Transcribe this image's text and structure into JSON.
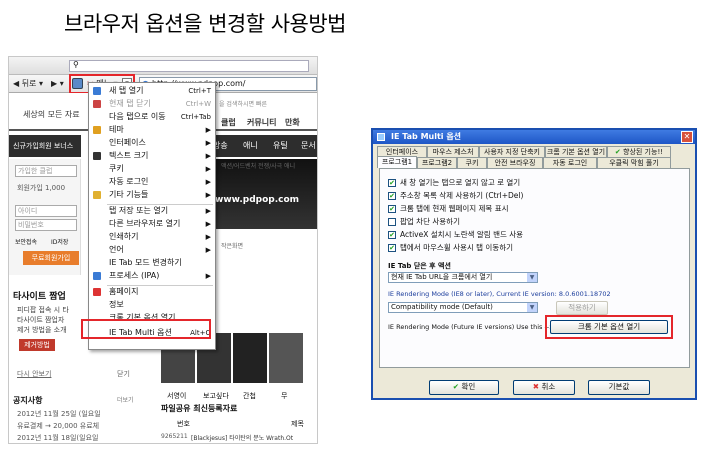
{
  "title": "브라우저 옵션을 변경할 사용방법",
  "browser": {
    "nav_back": "◀ 뒤로 ▾",
    "nav_fwd": "▶ ▾",
    "menu_button": "메뉴 ▾",
    "address": "http://www.pdpop.com/",
    "site": {
      "tagline": "세상의 모든 자료",
      "top_links": [
        "클럽",
        "커뮤니티",
        "만화"
      ],
      "notice_text": "신규가입회원 보너스",
      "gnb_items": [
        "방송",
        "애니",
        "유틸",
        "문서"
      ],
      "search_placeholder": "가입한 클럽",
      "join_line": "회원가입 1,000",
      "id_placeholder": "아이디",
      "pw_placeholder": "비밀번호",
      "login_opts": [
        "보안접속",
        "ID저장"
      ],
      "free_button": "무료회원가입",
      "banner_domain": "www.pdpop.com",
      "banner_hint": "작은화면",
      "caption_row": "액션/어드벤처 전쟁/사극 애니",
      "side_heading": "타사이트 짬업",
      "side_lines": [
        "피디팝 접속 시 타",
        "타사이트 짬업자",
        "제거 방법을 소개"
      ],
      "remove_button": "제거방법",
      "show_again": "다시 안보기",
      "close": "닫기",
      "movie_titles": [
        "서영이",
        "보고싶다",
        "간첩",
        "무"
      ],
      "notice_heading": "공지사항",
      "notice_more": "더보기",
      "notices": [
        "2012년 11월 25일 (일요일",
        "유료결제 → 20,000 유료체",
        "2012년 11월 18일(일요일"
      ],
      "files_heading": "파일공유 최신등록자료",
      "files_cols": [
        "번호",
        "제목"
      ],
      "file_row": [
        "9265211",
        "[Blackjesus] 타이탄의 분노 Wrath.Ot"
      ],
      "search_note": "을 검색하시면 빠른"
    },
    "menu": [
      {
        "label": "새 탭 열기",
        "shortcut": "Ctrl+T",
        "icon": "#3a7bd5",
        "disabled": false
      },
      {
        "label": "현재 탭 닫기",
        "shortcut": "Ctrl+W",
        "icon": "#c44",
        "disabled": true
      },
      {
        "label": "다음 탭으로 이동",
        "shortcut": "Ctrl+Tab",
        "icon": "",
        "disabled": false
      },
      {
        "label": "테마",
        "shortcut": "",
        "icon": "#e0a020",
        "arrow": true
      },
      {
        "label": "인터페이스",
        "shortcut": "",
        "icon": "",
        "arrow": true
      },
      {
        "label": "텍스트 크기",
        "shortcut": "",
        "icon": "#333",
        "arrow": true
      },
      {
        "label": "쿠키",
        "shortcut": "",
        "icon": "",
        "arrow": true
      },
      {
        "label": "자동 로그인",
        "shortcut": "",
        "icon": "",
        "arrow": true
      },
      {
        "label": "기타 기능들",
        "shortcut": "",
        "icon": "#e0b030",
        "arrow": true
      },
      {
        "label": "탭 저장 또는 열기",
        "shortcut": "",
        "icon": "",
        "arrow": true,
        "sep_before": true
      },
      {
        "label": "다른 브라우저로 열기",
        "shortcut": "",
        "icon": "",
        "arrow": true
      },
      {
        "label": "인쇄하기",
        "shortcut": "",
        "icon": "",
        "arrow": true
      },
      {
        "label": "언어",
        "shortcut": "",
        "icon": "",
        "arrow": true
      },
      {
        "label": "IE Tab 모드 변경하기",
        "shortcut": "",
        "icon": "",
        "arrow": false
      },
      {
        "label": "프로세스 (IPA)",
        "shortcut": "",
        "icon": "#3a7bd5",
        "arrow": true
      },
      {
        "label": "홈페이지",
        "shortcut": "",
        "icon": "#d33",
        "arrow": false,
        "sep_before": true
      },
      {
        "label": "정보",
        "shortcut": "",
        "icon": "",
        "arrow": false
      },
      {
        "label": "크롬 기본 옵션 열기",
        "shortcut": "",
        "icon": "",
        "arrow": false
      },
      {
        "label": "IE Tab Multi 옵션",
        "shortcut": "Alt+O",
        "icon": "",
        "arrow": false,
        "highlight": true
      }
    ]
  },
  "dialog": {
    "title": "IE Tab Multi 옵션",
    "tabs_row1": [
      "인터페이스",
      "마우스 제스처",
      "사용자 지정 단축키",
      "크롬 기본 옵션 열기",
      "향상된 기능!!"
    ],
    "tabs_row2": [
      "프로그램1",
      "프로그램2",
      "쿠키",
      "안전 브라우징",
      "자동 로그인",
      "우클릭 막힘 풀기"
    ],
    "checks": [
      {
        "label": "새 창 열기는 탭으로 열지 않고 로 열기",
        "checked": true
      },
      {
        "label": "주소창 목록 삭제 사용하기 (Ctrl+Del)",
        "checked": true
      },
      {
        "label": "크롬 탭에 현재 웹페이지 제목 표시",
        "checked": true
      },
      {
        "label": "팝업 차단 사용하기",
        "checked": false
      },
      {
        "label": "ActiveX 설치시 노란색 알림 밴드 사용",
        "checked": true
      },
      {
        "label": "탭에서 마우스휠 사용시 탭 이동하기",
        "checked": true
      }
    ],
    "after_close_label": "IE Tab 닫은 후 액션",
    "after_close_value": "현재 IE Tab URL을 크롬에서 열기",
    "rendering_info": "IE Rendering Mode (IE8 or later), Current IE version: 8.0.6001.18702",
    "compat_value": "Compatibility mode (Default)",
    "apply_label": "적용하기",
    "future_label": "IE Rendering Mode (Future IE versions) Use this -->",
    "chrome_open_label": "크롬 기본 옵션 열기",
    "ok_label": "확인",
    "cancel_label": "취소",
    "default_label": "기본값",
    "colors": {
      "highlight": "#e4262b",
      "titlebar": "#1e56c6",
      "ok_icon": "#21a121",
      "cancel_icon": "#d33"
    }
  }
}
